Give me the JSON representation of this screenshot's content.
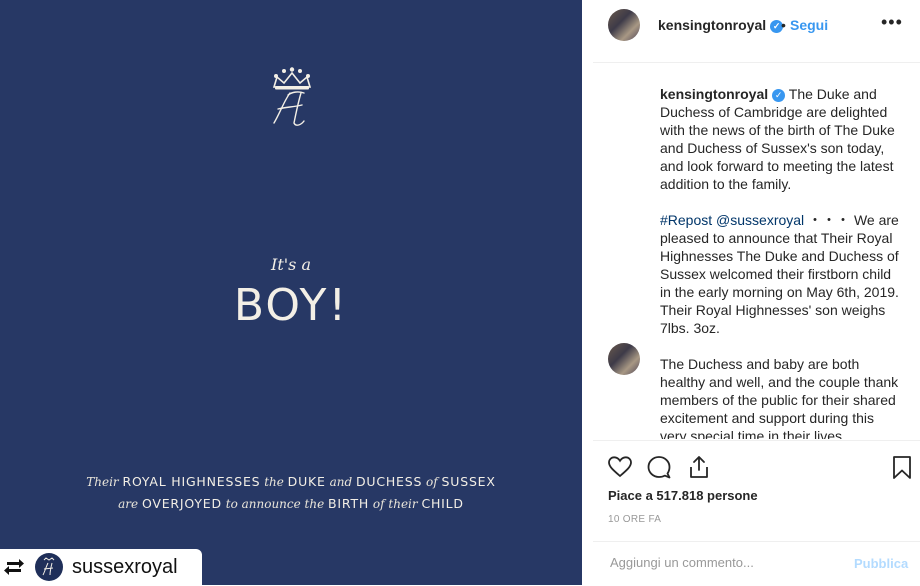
{
  "image": {
    "its_a": "It's a",
    "boy": "BOY!",
    "announcement": {
      "line1": [
        {
          "text": "Their ",
          "style": "ital"
        },
        {
          "text": "ROYAL HIGHNESSES",
          "style": "caps"
        },
        {
          "text": " the ",
          "style": "ital"
        },
        {
          "text": "DUKE",
          "style": "caps"
        },
        {
          "text": " and ",
          "style": "ital"
        },
        {
          "text": "DUCHESS",
          "style": "caps"
        },
        {
          "text": " of ",
          "style": "ital"
        },
        {
          "text": "SUSSEX",
          "style": "caps"
        }
      ],
      "line2": [
        {
          "text": "are ",
          "style": "ital"
        },
        {
          "text": "OVERJOYED",
          "style": "caps"
        },
        {
          "text": " to announce the ",
          "style": "ital"
        },
        {
          "text": "BIRTH",
          "style": "caps"
        },
        {
          "text": " of their ",
          "style": "ital"
        },
        {
          "text": "CHILD",
          "style": "caps"
        }
      ]
    },
    "repost_username": "sussexroyal",
    "background_color": "#273865"
  },
  "header": {
    "username": "kensingtonroyal",
    "separator": "•",
    "follow": "Segui",
    "more": "•••"
  },
  "caption": {
    "username": "kensingtonroyal",
    "p1": "The Duke and Duchess of Cambridge are delighted with the news of the birth of The Duke and Duchess of Sussex's son today, and look forward to meeting the latest addition to the family.",
    "repost_tag": "#Repost @sussexroyal",
    "repost_dots": " ・・・ ",
    "p2": "We are pleased to announce that Their Royal Highnesses The Duke and Duchess of Sussex welcomed their firstborn child in the early morning on May 6th, 2019. Their Royal Highnesses' son weighs 7lbs. 3oz.",
    "p3": "The Duchess and baby are both healthy and well, and the couple thank members of the public for their shared excitement and support during this very special time in their lives."
  },
  "stats": {
    "likes": "Piace a 517.818 persone",
    "time_ago": "10 ORE FA"
  },
  "comment": {
    "placeholder": "Aggiungi un commento...",
    "publish": "Pubblica"
  },
  "colors": {
    "accent": "#3897f0",
    "hashtag": "#003569",
    "publish_disabled": "#b3dbff"
  }
}
